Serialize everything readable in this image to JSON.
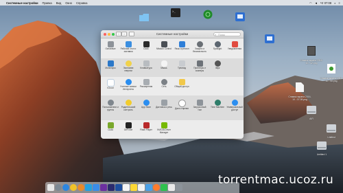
{
  "menubar": {
    "app_name": "Системные настройки",
    "menus": [
      "Правка",
      "Вид",
      "Окно",
      "Справка"
    ],
    "time": "Чт 07:08"
  },
  "window": {
    "title": "Системные настройки",
    "search_placeholder": "Поиск",
    "rows": [
      [
        "Основные",
        "Рабочий стол и заставка",
        "Dock",
        "Mission Control",
        "Язык и регион",
        "Защита и безопасность",
        "Spotlight",
        "Уведомления"
      ],
      [
        "Мониторы",
        "Экономия энергии",
        "Клавиатура",
        "Мышь",
        "Трекпад",
        "Принтеры и сканеры",
        "Звук"
      ],
      [
        "iCloud",
        "Учетные записи Интернета",
        "Расширения",
        "Сеть",
        "Общий доступ"
      ],
      [
        "Пользователи и группы",
        "Родительский контроль",
        "App Store",
        "Диктовка и речь",
        "Дата и время",
        "Загрузочный том",
        "Time Machine",
        "Универсальный доступ"
      ],
      [
        "Cuda",
        "GeForce",
        "Flash Player",
        "NVIDIA Driver Manager"
      ]
    ]
  },
  "desktop": {
    "icons": [
      {
        "name": "folder",
        "label": ""
      },
      {
        "name": "terminal",
        "label": ""
      },
      {
        "name": "globe-app",
        "label": ""
      },
      {
        "name": "network-app",
        "label": ""
      },
      {
        "name": "network-app-2",
        "label": ""
      },
      {
        "name": "screenshot-1",
        "label": "Снимок экрана 2016-10...42.png"
      },
      {
        "name": "screenshot-2",
        "label": "Снимок экрана 2016-10...08.png"
      },
      {
        "name": "document",
        "label": "Снимок экрана 2016-10...07.08.png"
      },
      {
        "name": "disk-1",
        "label": "AIR"
      },
      {
        "name": "disk-2",
        "label": "Untitled"
      },
      {
        "name": "disk-3",
        "label": "Untitled 1"
      }
    ]
  },
  "watermark": "torrentmac.ucoz.ru",
  "colors": {
    "menubar": "#e6e8ec",
    "window_bg": "#ececec",
    "accent": "#2b8ef0"
  }
}
